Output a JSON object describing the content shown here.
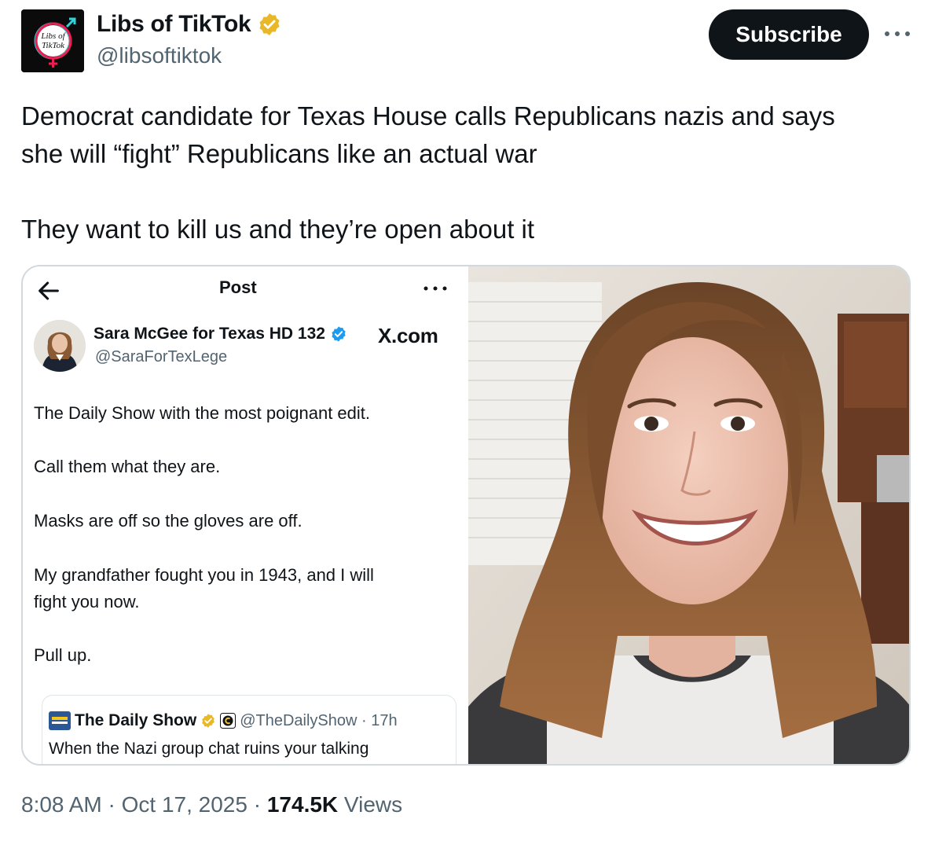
{
  "account": {
    "name": "Libs of TikTok",
    "handle": "@libsoftiktok",
    "avatar_text_1": "Libs of",
    "avatar_text_2": "TikTok",
    "verified_color": "#e8b829"
  },
  "header": {
    "subscribe_label": "Subscribe",
    "more_icon": "more-horizontal-icon"
  },
  "tweet": {
    "line1": "Democrat candidate for Texas House calls Republicans nazis and says",
    "line2": "she will “fight” Republicans like an actual war",
    "line3": "They want to kill us and they’re open about it"
  },
  "embedded_post": {
    "title": "Post",
    "author_name": "Sara McGee for Texas HD 132",
    "author_handle": "@SaraForTexLege",
    "watermark": "X.com",
    "lines": [
      "The Daily Show with the most poignant edit.",
      "Call them what they are.",
      "Masks are off so the gloves are off.",
      "My grandfather fought you in 1943, and I will",
      "fight you now.",
      "Pull up."
    ],
    "quote": {
      "name": "The Daily Show",
      "meta": "@TheDailyShow · 17h",
      "text": "When the Nazi group chat ruins your talking"
    }
  },
  "footer": {
    "time": "8:08 AM",
    "sep1": " · ",
    "date": "Oct 17, 2025",
    "sep2": " · ",
    "views_count": "174.5K",
    "views_label": " Views"
  }
}
